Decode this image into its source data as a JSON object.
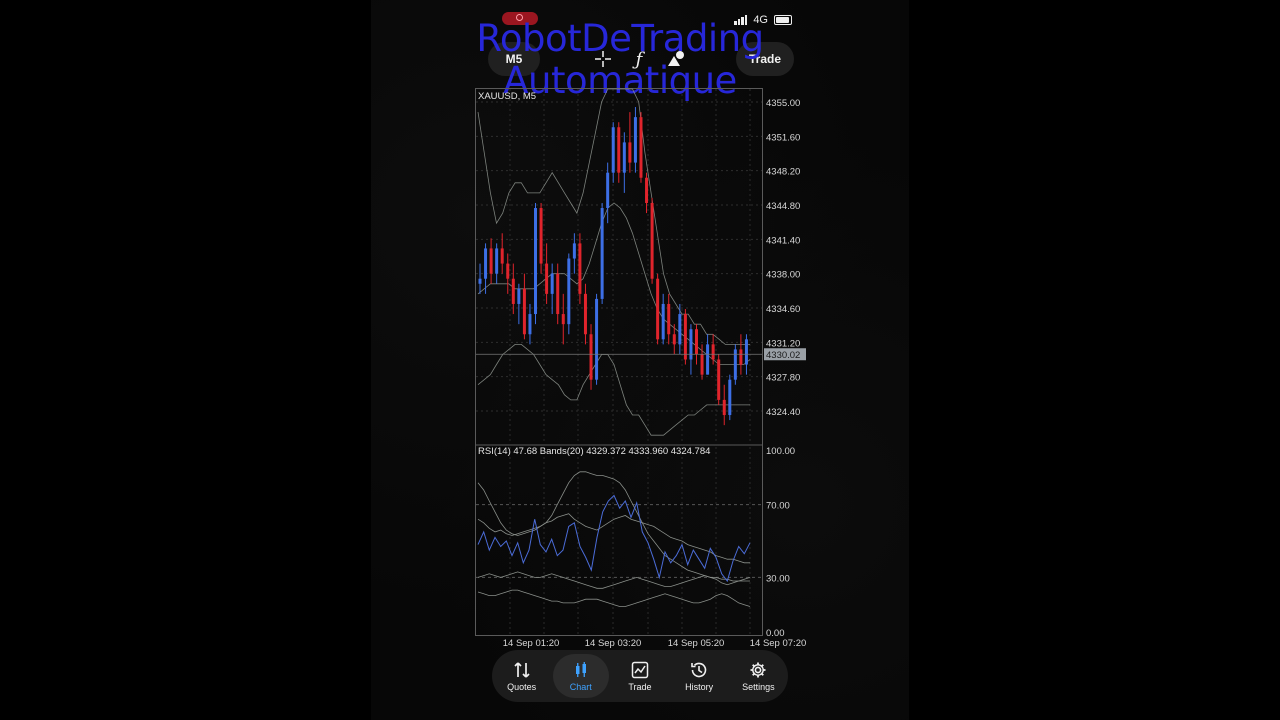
{
  "status_bar": {
    "network": "4G"
  },
  "toolbar": {
    "timeframe": "M5",
    "trade_label": "Trade"
  },
  "watermark": {
    "line1": "RobotDeTrading",
    "line2": "Automatique"
  },
  "colors": {
    "bull": "#3d6fe6",
    "bear": "#e0242c",
    "band": "#9aa09a",
    "rsi": "#4b6cd8",
    "accent": "#3ea2ff"
  },
  "chart_data": [
    {
      "type": "candlestick",
      "title": "XAUUSD, M5",
      "ylim": [
        4322.0,
        4356.5
      ],
      "y_ticks": [
        "4355.00",
        "4351.60",
        "4348.20",
        "4344.80",
        "4341.40",
        "4338.00",
        "4334.60",
        "4331.20",
        "4327.80",
        "4324.40"
      ],
      "current_price": "4330.02",
      "x_ticks": [
        "14 Sep 01:20",
        "14 Sep 03:20",
        "14 Sep 05:20",
        "14 Sep 07:20"
      ],
      "candles": [
        [
          4337,
          4339,
          4336,
          4337.5
        ],
        [
          4337.5,
          4341,
          4336,
          4340.5
        ],
        [
          4340.5,
          4341.5,
          4337,
          4338
        ],
        [
          4338,
          4341,
          4337,
          4340.5
        ],
        [
          4340.5,
          4342,
          4338,
          4339
        ],
        [
          4339,
          4340,
          4336,
          4337.5
        ],
        [
          4337.5,
          4339,
          4334,
          4335
        ],
        [
          4335,
          4337,
          4333,
          4336.5
        ],
        [
          4336.5,
          4338,
          4331.5,
          4332
        ],
        [
          4332,
          4335,
          4331,
          4334
        ],
        [
          4334,
          4345,
          4333,
          4344.5
        ],
        [
          4344.5,
          4345,
          4338,
          4339
        ],
        [
          4339,
          4341,
          4335,
          4336
        ],
        [
          4336,
          4339,
          4334,
          4338
        ],
        [
          4338,
          4339,
          4333,
          4334
        ],
        [
          4334,
          4336,
          4331,
          4333
        ],
        [
          4333,
          4340,
          4332,
          4339.5
        ],
        [
          4339.5,
          4342,
          4338,
          4341
        ],
        [
          4341,
          4342,
          4335,
          4336
        ],
        [
          4336,
          4337,
          4331,
          4332
        ],
        [
          4332,
          4333,
          4326.5,
          4327.5
        ],
        [
          4327.5,
          4336,
          4327,
          4335.5
        ],
        [
          4335.5,
          4345,
          4335,
          4344.5
        ],
        [
          4344.5,
          4349,
          4343,
          4348
        ],
        [
          4348,
          4353,
          4347,
          4352.5
        ],
        [
          4352.5,
          4353,
          4347,
          4348
        ],
        [
          4348,
          4352,
          4346,
          4351
        ],
        [
          4351,
          4354,
          4348,
          4349
        ],
        [
          4349,
          4354.5,
          4348,
          4353.5
        ],
        [
          4353.5,
          4354,
          4347,
          4347.5
        ],
        [
          4347.5,
          4348,
          4344,
          4345
        ],
        [
          4345,
          4345.5,
          4337,
          4337.5
        ],
        [
          4337.5,
          4338,
          4331,
          4331.5
        ],
        [
          4331.5,
          4336,
          4331,
          4335
        ],
        [
          4335,
          4336,
          4331,
          4332
        ],
        [
          4332,
          4333,
          4330,
          4331
        ],
        [
          4331,
          4335,
          4330,
          4334
        ],
        [
          4334,
          4334.5,
          4329,
          4329.5
        ],
        [
          4329.5,
          4333,
          4328,
          4332.5
        ],
        [
          4332.5,
          4333,
          4329,
          4330
        ],
        [
          4330,
          4331,
          4327.5,
          4328
        ],
        [
          4328,
          4332,
          4328,
          4331
        ],
        [
          4331,
          4332,
          4329,
          4329.5
        ],
        [
          4329.5,
          4330,
          4325,
          4325.5
        ],
        [
          4325.5,
          4327,
          4323,
          4324
        ],
        [
          4324,
          4328,
          4323.5,
          4327.5
        ],
        [
          4327.5,
          4331,
          4327,
          4330.5
        ],
        [
          4330.5,
          4332,
          4328,
          4329
        ],
        [
          4329,
          4332,
          4328,
          4331.5
        ]
      ]
    },
    {
      "type": "line",
      "title": "RSI(14) 47.68 Bands(20) 4329.372 4333.960 4324.784",
      "ylim": [
        0,
        100
      ],
      "y_ticks": [
        "100.00",
        "70.00",
        "30.00",
        "0.00"
      ],
      "series_levels": [
        70,
        30
      ],
      "rsi": [
        48,
        55,
        45,
        52,
        47,
        50,
        42,
        49,
        38,
        45,
        62,
        48,
        44,
        51,
        42,
        45,
        58,
        60,
        47,
        41,
        34,
        52,
        66,
        72,
        75,
        68,
        72,
        63,
        71,
        55,
        49,
        40,
        30,
        44,
        38,
        42,
        48,
        37,
        45,
        40,
        35,
        46,
        41,
        32,
        28,
        39,
        47,
        43,
        49
      ],
      "upper": [
        62,
        60,
        57,
        55,
        56,
        54,
        53,
        54,
        55,
        56,
        57,
        58,
        60,
        61,
        63,
        64,
        65,
        62,
        60,
        58,
        57,
        56,
        58,
        60,
        62,
        63,
        64,
        62,
        61,
        60,
        59,
        58,
        56,
        54,
        52,
        51,
        50,
        48,
        47,
        46,
        45,
        44,
        42,
        41,
        40,
        40,
        39,
        38,
        38
      ],
      "lower": [
        30,
        31,
        32,
        31,
        30,
        31,
        32,
        33,
        32,
        31,
        30,
        30,
        31,
        32,
        31,
        30,
        29,
        28,
        27,
        26,
        25,
        24,
        24,
        25,
        26,
        27,
        28,
        29,
        30,
        29,
        28,
        27,
        26,
        25,
        25,
        26,
        27,
        28,
        29,
        30,
        31,
        30,
        29,
        27,
        26,
        27,
        28,
        29,
        30
      ],
      "outer": [
        82,
        78,
        72,
        66,
        60,
        56,
        54,
        53,
        54,
        55,
        56,
        58,
        60,
        64,
        70,
        76,
        82,
        86,
        88,
        88,
        87,
        86,
        86,
        85,
        84,
        82,
        78,
        72,
        66,
        60,
        54,
        50,
        46,
        42,
        40,
        38,
        36,
        34,
        33,
        32,
        31,
        30,
        30,
        29,
        29,
        28,
        28,
        28,
        28
      ],
      "outer_low": [
        22,
        21,
        20,
        20,
        21,
        22,
        23,
        23,
        22,
        21,
        20,
        19,
        18,
        17,
        17,
        16,
        16,
        16,
        17,
        18,
        18,
        18,
        17,
        16,
        15,
        14,
        14,
        15,
        16,
        17,
        18,
        19,
        20,
        21,
        20,
        19,
        18,
        17,
        16,
        16,
        17,
        18,
        20,
        21,
        20,
        18,
        16,
        15,
        14
      ]
    }
  ],
  "bands_main": {
    "upper": [
      4354,
      4350,
      4346,
      4343,
      4344,
      4346,
      4347,
      4347,
      4346,
      4346,
      4346,
      4347,
      4348,
      4347,
      4346,
      4345,
      4344,
      4346,
      4349,
      4352,
      4355,
      4357,
      4358,
      4358,
      4358,
      4357,
      4355,
      4350,
      4346,
      4342,
      4338,
      4336,
      4335,
      4334,
      4334,
      4333,
      4333,
      4332,
      4332,
      4331.5,
      4331,
      4331,
      4331,
      4331,
      4331
    ],
    "middle": [
      4336,
      4336.5,
      4337,
      4337,
      4337,
      4337,
      4336.5,
      4336.5,
      4336.5,
      4336.5,
      4337,
      4337.5,
      4338,
      4338,
      4338,
      4337.5,
      4337,
      4337.5,
      4339,
      4341,
      4343,
      4344.5,
      4345,
      4344.5,
      4343.5,
      4342,
      4340,
      4338,
      4336,
      4334.5,
      4333.5,
      4333,
      4332.5,
      4332,
      4331.5,
      4331,
      4330.5,
      4330,
      4329.5,
      4329,
      4329,
      4329,
      4329,
      4329,
      4329.5
    ],
    "lower": [
      4327,
      4327.5,
      4328,
      4329,
      4330,
      4330.5,
      4331,
      4331,
      4330.5,
      4330,
      4329,
      4328,
      4327.5,
      4327,
      4326,
      4325.5,
      4325.5,
      4327,
      4328,
      4329,
      4330,
      4330,
      4329,
      4327,
      4325,
      4324,
      4324,
      4323,
      4322,
      4322,
      4322,
      4322.5,
      4323,
      4323.5,
      4324,
      4324,
      4324.5,
      4325,
      4325,
      4325,
      4325,
      4325,
      4325,
      4325,
      4325
    ]
  },
  "tabs": [
    {
      "label": "Quotes",
      "icon": "quotes-arrows-icon"
    },
    {
      "label": "Chart",
      "icon": "candlestick-icon",
      "active": true
    },
    {
      "label": "Trade",
      "icon": "trend-line-icon"
    },
    {
      "label": "History",
      "icon": "history-clock-icon"
    },
    {
      "label": "Settings",
      "icon": "gear-icon"
    }
  ]
}
